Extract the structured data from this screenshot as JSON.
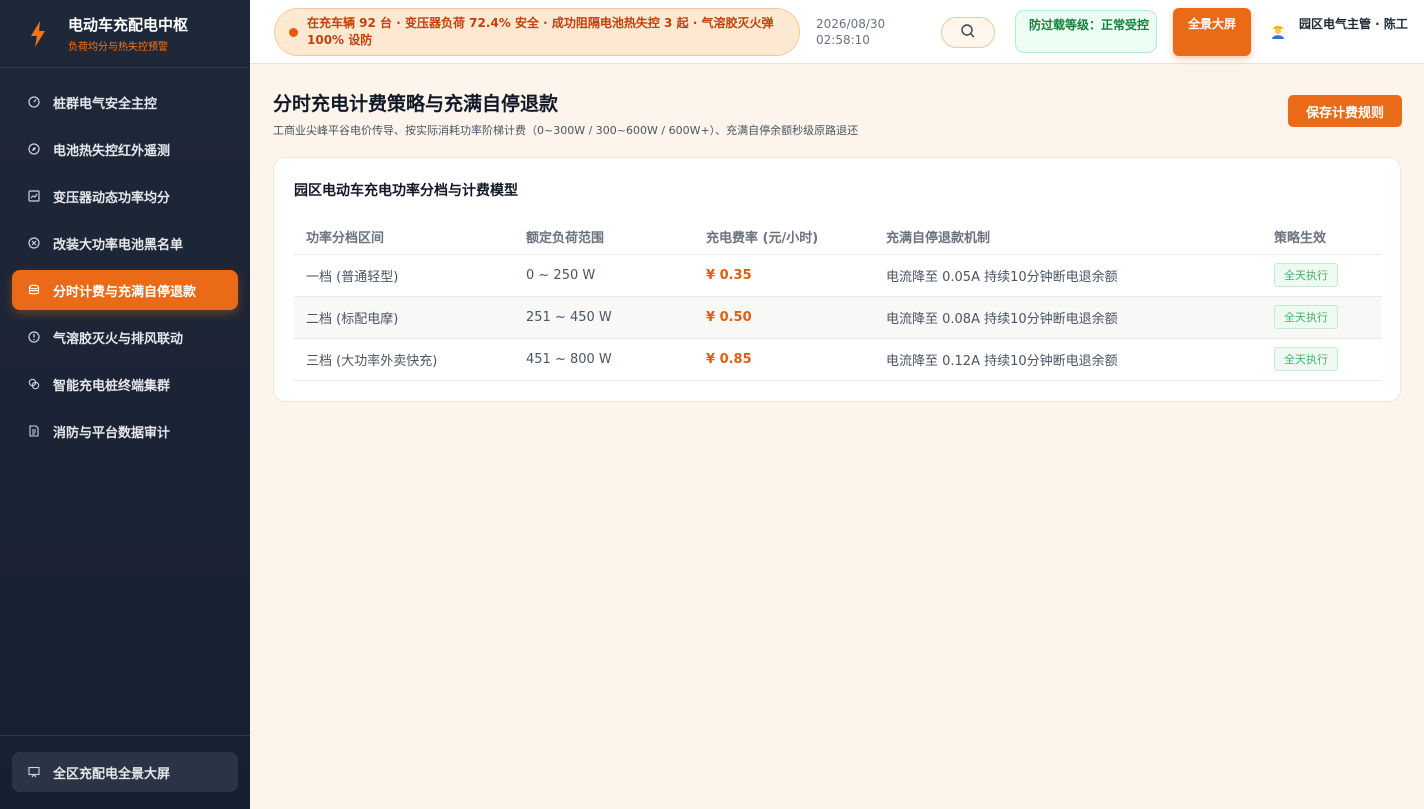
{
  "brand": {
    "title": "电动车充配电中枢",
    "subtitle": "负荷均分与热失控预警"
  },
  "sidebar": {
    "items": [
      {
        "label": "桩群电气安全主控",
        "icon": "gauge-icon",
        "active": false
      },
      {
        "label": "电池热失控红外遥测",
        "icon": "compass-icon",
        "active": false
      },
      {
        "label": "变压器动态功率均分",
        "icon": "chart-icon",
        "active": false
      },
      {
        "label": "改装大功率电池黑名单",
        "icon": "block-icon",
        "active": false
      },
      {
        "label": "分时计费与充满自停退款",
        "icon": "database-icon",
        "active": true
      },
      {
        "label": "气溶胶灭火与排风联动",
        "icon": "alert-icon",
        "active": false
      },
      {
        "label": "智能充电桩终端集群",
        "icon": "cluster-icon",
        "active": false
      },
      {
        "label": "消防与平台数据审计",
        "icon": "document-icon",
        "active": false
      }
    ],
    "footer_label": "全区充配电全景大屏"
  },
  "topbar": {
    "ticker": "在充车辆 92 台 · 变压器负荷 72.4% 安全 · 成功阻隔电池热失控 3 起 · 气溶胶灭火弹 100% 设防",
    "date": "2026/08/30",
    "time": "02:58:10",
    "level": "防过载等级：正常受控",
    "fullscreen_label": "全景大屏",
    "user": "园区电气主管 · 陈工"
  },
  "main": {
    "title": "分时充电计费策略与充满自停退款",
    "description": "工商业尖峰平谷电价传导、按实际消耗功率阶梯计费（0~300W / 300~600W / 600W+）、充满自停余额秒级原路退还",
    "save_label": "保存计费规则",
    "card_title": "园区电动车充电功率分档与计费模型",
    "columns": [
      "功率分档区间",
      "额定负荷范围",
      "充电费率 (元/小时)",
      "充满自停退款机制",
      "策略生效"
    ],
    "rows": [
      {
        "tier": "一档 (普通轻型)",
        "range": "0 ~ 250 W",
        "rate": "¥ 0.35",
        "refund": "电流降至 0.05A 持续10分钟断电退余额",
        "status": "全天执行"
      },
      {
        "tier": "二档 (标配电摩)",
        "range": "251 ~ 450 W",
        "rate": "¥ 0.50",
        "refund": "电流降至 0.08A 持续10分钟断电退余额",
        "status": "全天执行"
      },
      {
        "tier": "三档 (大功率外卖快充)",
        "range": "451 ~ 800 W",
        "rate": "¥ 0.85",
        "refund": "电流降至 0.12A 持续10分钟断电退余额",
        "status": "全天执行"
      }
    ]
  },
  "colors": {
    "accent": "#ea6a17",
    "sidebar_bg": "#1f2838",
    "success": "#15803d",
    "page_bg": "#fdf5ec"
  }
}
